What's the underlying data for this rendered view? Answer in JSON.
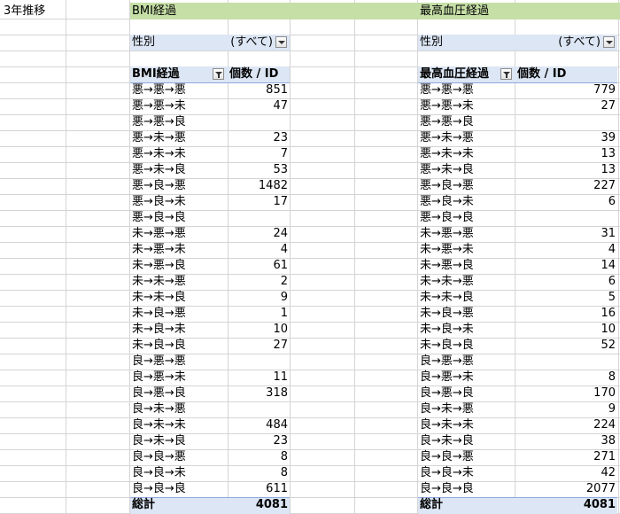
{
  "sheet": {
    "corner_label": "3年推移",
    "bmi": {
      "title": "BMI経過",
      "filter": {
        "label": "性別",
        "value": "(すべて)"
      },
      "header": {
        "row_label": "BMI経過",
        "value_label": "個数 / ID"
      },
      "rows": [
        {
          "label": "悪→悪→悪",
          "value": "851"
        },
        {
          "label": "悪→悪→未",
          "value": "47"
        },
        {
          "label": "悪→悪→良",
          "value": ""
        },
        {
          "label": "悪→未→悪",
          "value": "23"
        },
        {
          "label": "悪→未→未",
          "value": "7"
        },
        {
          "label": "悪→未→良",
          "value": "53"
        },
        {
          "label": "悪→良→悪",
          "value": "1482"
        },
        {
          "label": "悪→良→未",
          "value": "17"
        },
        {
          "label": "悪→良→良",
          "value": ""
        },
        {
          "label": "未→悪→悪",
          "value": "24"
        },
        {
          "label": "未→悪→未",
          "value": "4"
        },
        {
          "label": "未→悪→良",
          "value": "61"
        },
        {
          "label": "未→未→悪",
          "value": "2"
        },
        {
          "label": "未→未→良",
          "value": "9"
        },
        {
          "label": "未→良→悪",
          "value": "1"
        },
        {
          "label": "未→良→未",
          "value": "10"
        },
        {
          "label": "未→良→良",
          "value": "27"
        },
        {
          "label": "良→悪→悪",
          "value": ""
        },
        {
          "label": "良→悪→未",
          "value": "11"
        },
        {
          "label": "良→悪→良",
          "value": "318"
        },
        {
          "label": "良→未→悪",
          "value": ""
        },
        {
          "label": "良→未→未",
          "value": "484"
        },
        {
          "label": "良→未→良",
          "value": "23"
        },
        {
          "label": "良→良→悪",
          "value": "8"
        },
        {
          "label": "良→良→未",
          "value": "8"
        },
        {
          "label": "良→良→良",
          "value": "611"
        }
      ],
      "total": {
        "label": "総計",
        "value": "4081"
      }
    },
    "bp": {
      "title": "最高血圧経過",
      "filter": {
        "label": "性別",
        "value": "(すべて)"
      },
      "header": {
        "row_label": "最高血圧経過",
        "value_label": "個数 / ID"
      },
      "rows": [
        {
          "label": "悪→悪→悪",
          "value": "779"
        },
        {
          "label": "悪→悪→未",
          "value": "27"
        },
        {
          "label": "悪→悪→良",
          "value": ""
        },
        {
          "label": "悪→未→悪",
          "value": "39"
        },
        {
          "label": "悪→未→未",
          "value": "13"
        },
        {
          "label": "悪→未→良",
          "value": "13"
        },
        {
          "label": "悪→良→悪",
          "value": "227"
        },
        {
          "label": "悪→良→未",
          "value": "6"
        },
        {
          "label": "悪→良→良",
          "value": ""
        },
        {
          "label": "未→悪→悪",
          "value": "31"
        },
        {
          "label": "未→悪→未",
          "value": "4"
        },
        {
          "label": "未→悪→良",
          "value": "14"
        },
        {
          "label": "未→未→悪",
          "value": "6"
        },
        {
          "label": "未→未→良",
          "value": "5"
        },
        {
          "label": "未→良→悪",
          "value": "16"
        },
        {
          "label": "未→良→未",
          "value": "10"
        },
        {
          "label": "未→良→良",
          "value": "52"
        },
        {
          "label": "良→悪→悪",
          "value": ""
        },
        {
          "label": "良→悪→未",
          "value": "8"
        },
        {
          "label": "良→悪→良",
          "value": "170"
        },
        {
          "label": "良→未→悪",
          "value": "9"
        },
        {
          "label": "良→未→未",
          "value": "224"
        },
        {
          "label": "良→未→良",
          "value": "38"
        },
        {
          "label": "良→良→悪",
          "value": "271"
        },
        {
          "label": "良→良→未",
          "value": "42"
        },
        {
          "label": "良→良→良",
          "value": "2077"
        }
      ],
      "total": {
        "label": "総計",
        "value": "4081"
      }
    }
  },
  "colors": {
    "title_band": "#c6dfa7",
    "pivot_header": "#dce6f4",
    "grid": "#d4d4d4"
  }
}
